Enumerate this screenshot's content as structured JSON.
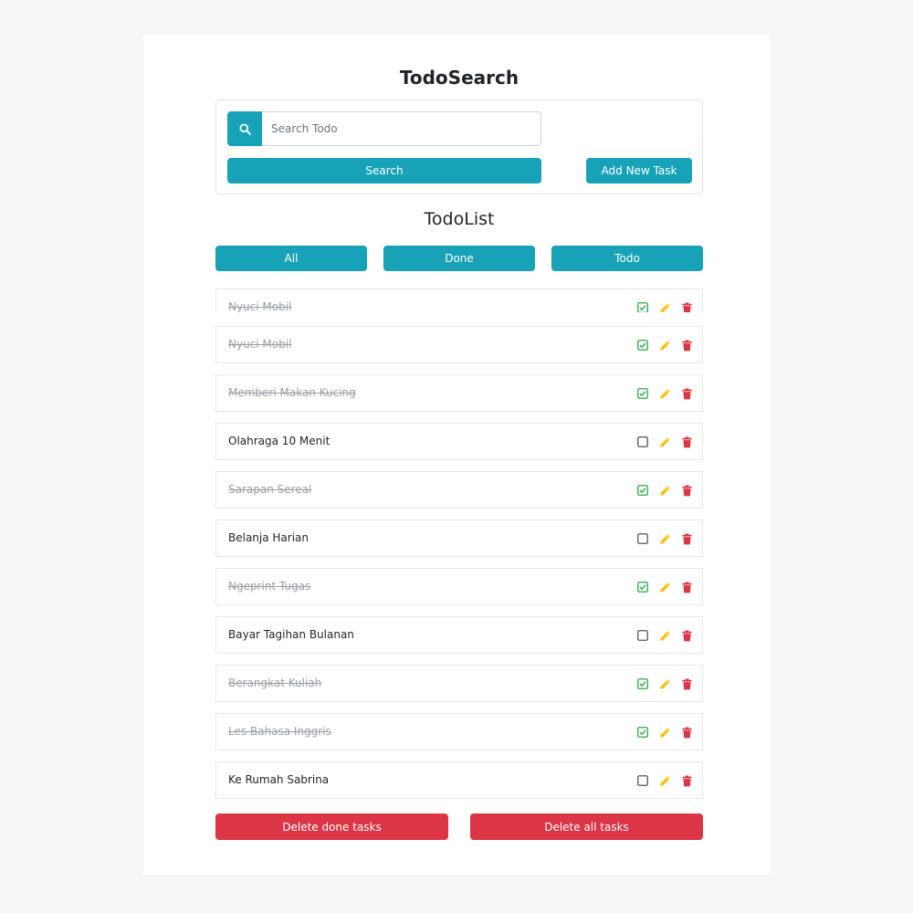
{
  "header": {
    "title": "TodoSearch"
  },
  "search": {
    "placeholder": "Search Todo",
    "value": "",
    "search_label": "Search",
    "add_label": "Add New Task"
  },
  "list_section": {
    "title": "TodoList"
  },
  "filters": {
    "all_label": "All",
    "done_label": "Done",
    "todo_label": "Todo"
  },
  "todos": [
    {
      "text": "Nyuci Mobil",
      "done": true
    },
    {
      "text": "Nyuci Mobil",
      "done": true
    },
    {
      "text": "Memberi Makan Kucing",
      "done": true
    },
    {
      "text": "Olahraga 10 Menit",
      "done": false
    },
    {
      "text": "Sarapan Sereal",
      "done": true
    },
    {
      "text": "Belanja Harian",
      "done": false
    },
    {
      "text": "Ngeprint Tugas",
      "done": true
    },
    {
      "text": "Bayar Tagihan Bulanan",
      "done": false
    },
    {
      "text": "Berangkat Kuliah",
      "done": true
    },
    {
      "text": "Les Bahasa Inggris",
      "done": true
    },
    {
      "text": "Ke Rumah Sabrina",
      "done": false
    }
  ],
  "footer": {
    "delete_done_label": "Delete done tasks",
    "delete_all_label": "Delete all tasks"
  },
  "icons": {
    "search": "search-icon",
    "checkbox_checked": "checkbox-checked-icon",
    "checkbox_empty": "checkbox-empty-icon",
    "edit": "pencil-icon",
    "delete": "trash-icon"
  },
  "colors": {
    "primary": "#17a2b8",
    "danger": "#dc3545",
    "warning": "#ffc107",
    "success": "#28a745"
  }
}
